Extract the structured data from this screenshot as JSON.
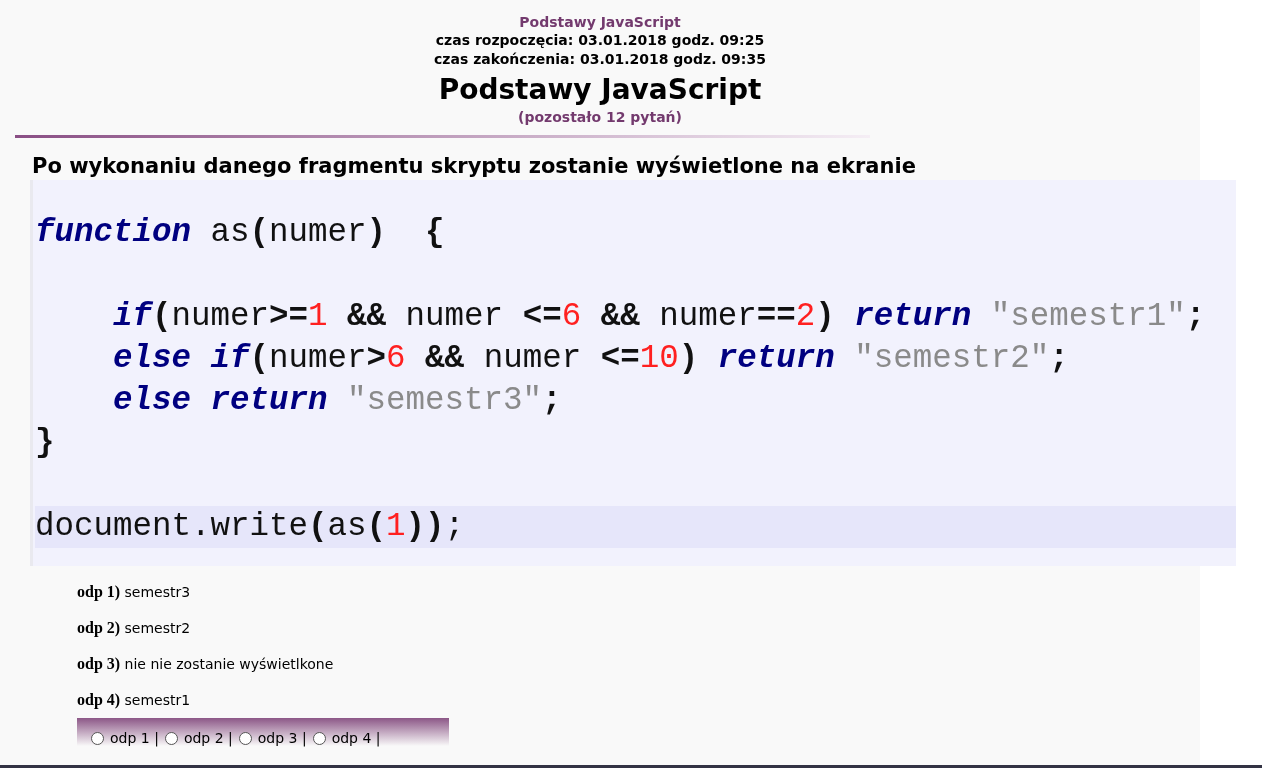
{
  "header": {
    "course": "Podstawy JavaScript",
    "start": "czas rozpoczęcia: 03.01.2018 godz. 09:25",
    "end": "czas zakończenia: 03.01.2018 godz. 09:35",
    "title": "Podstawy JavaScript",
    "remaining": "(pozostało 12 pytań)"
  },
  "question": "Po wykonaniu danego fragmentu skryptu zostanie wyświetlone na ekranie",
  "code": {
    "lines": [
      {
        "gap_before": false,
        "indented": false,
        "highlighted": false,
        "tokens": [
          {
            "kind": "kw",
            "text": "function"
          },
          {
            "kind": "plain",
            "text": " as"
          },
          {
            "kind": "op",
            "text": "("
          },
          {
            "kind": "plain",
            "text": "numer"
          },
          {
            "kind": "op",
            "text": ")  {"
          }
        ]
      },
      {
        "gap_before": true,
        "indented": true,
        "highlighted": false,
        "tokens": [
          {
            "kind": "kw",
            "text": "if"
          },
          {
            "kind": "op",
            "text": "("
          },
          {
            "kind": "plain",
            "text": "numer"
          },
          {
            "kind": "op",
            "text": ">="
          },
          {
            "kind": "num",
            "text": "1"
          },
          {
            "kind": "op",
            "text": " && "
          },
          {
            "kind": "plain",
            "text": "numer "
          },
          {
            "kind": "op",
            "text": "<="
          },
          {
            "kind": "num",
            "text": "6"
          },
          {
            "kind": "op",
            "text": " && "
          },
          {
            "kind": "plain",
            "text": "numer"
          },
          {
            "kind": "op",
            "text": "=="
          },
          {
            "kind": "num",
            "text": "2"
          },
          {
            "kind": "op",
            "text": ") "
          },
          {
            "kind": "kw",
            "text": "return"
          },
          {
            "kind": "str",
            "text": " \"semestr1\""
          },
          {
            "kind": "op",
            "text": ";"
          }
        ]
      },
      {
        "gap_before": false,
        "indented": true,
        "highlighted": false,
        "tokens": [
          {
            "kind": "kw",
            "text": "else if"
          },
          {
            "kind": "op",
            "text": "("
          },
          {
            "kind": "plain",
            "text": "numer"
          },
          {
            "kind": "op",
            "text": ">"
          },
          {
            "kind": "num",
            "text": "6"
          },
          {
            "kind": "op",
            "text": " && "
          },
          {
            "kind": "plain",
            "text": "numer "
          },
          {
            "kind": "op",
            "text": "<="
          },
          {
            "kind": "num",
            "text": "10"
          },
          {
            "kind": "op",
            "text": ") "
          },
          {
            "kind": "kw",
            "text": "return"
          },
          {
            "kind": "str",
            "text": " \"semestr2\""
          },
          {
            "kind": "op",
            "text": ";"
          }
        ]
      },
      {
        "gap_before": false,
        "indented": true,
        "highlighted": false,
        "tokens": [
          {
            "kind": "kw",
            "text": "else return"
          },
          {
            "kind": "str",
            "text": " \"semestr3\""
          },
          {
            "kind": "op",
            "text": ";"
          }
        ]
      },
      {
        "gap_before": false,
        "indented": false,
        "highlighted": false,
        "tokens": [
          {
            "kind": "op",
            "text": "}"
          }
        ]
      },
      {
        "gap_before": true,
        "indented": false,
        "highlighted": true,
        "tokens": [
          {
            "kind": "plain",
            "text": "document.write"
          },
          {
            "kind": "op",
            "text": "("
          },
          {
            "kind": "plain",
            "text": "as"
          },
          {
            "kind": "op",
            "text": "("
          },
          {
            "kind": "num",
            "text": "1"
          },
          {
            "kind": "op",
            "text": "))"
          },
          {
            "kind": "plain",
            "text": ";"
          }
        ]
      }
    ]
  },
  "answers": [
    {
      "label": "odp 1)",
      "text": "semestr3"
    },
    {
      "label": "odp 2)",
      "text": "semestr2"
    },
    {
      "label": "odp 3)",
      "text": "nie nie zostanie wyświetlkone"
    },
    {
      "label": "odp 4)",
      "text": "semestr1"
    }
  ],
  "choices": [
    {
      "label": "odp 1 |",
      "selected": false
    },
    {
      "label": "odp 2 |",
      "selected": false
    },
    {
      "label": "odp 3 |",
      "selected": false
    },
    {
      "label": "odp 4 |",
      "selected": false
    }
  ]
}
